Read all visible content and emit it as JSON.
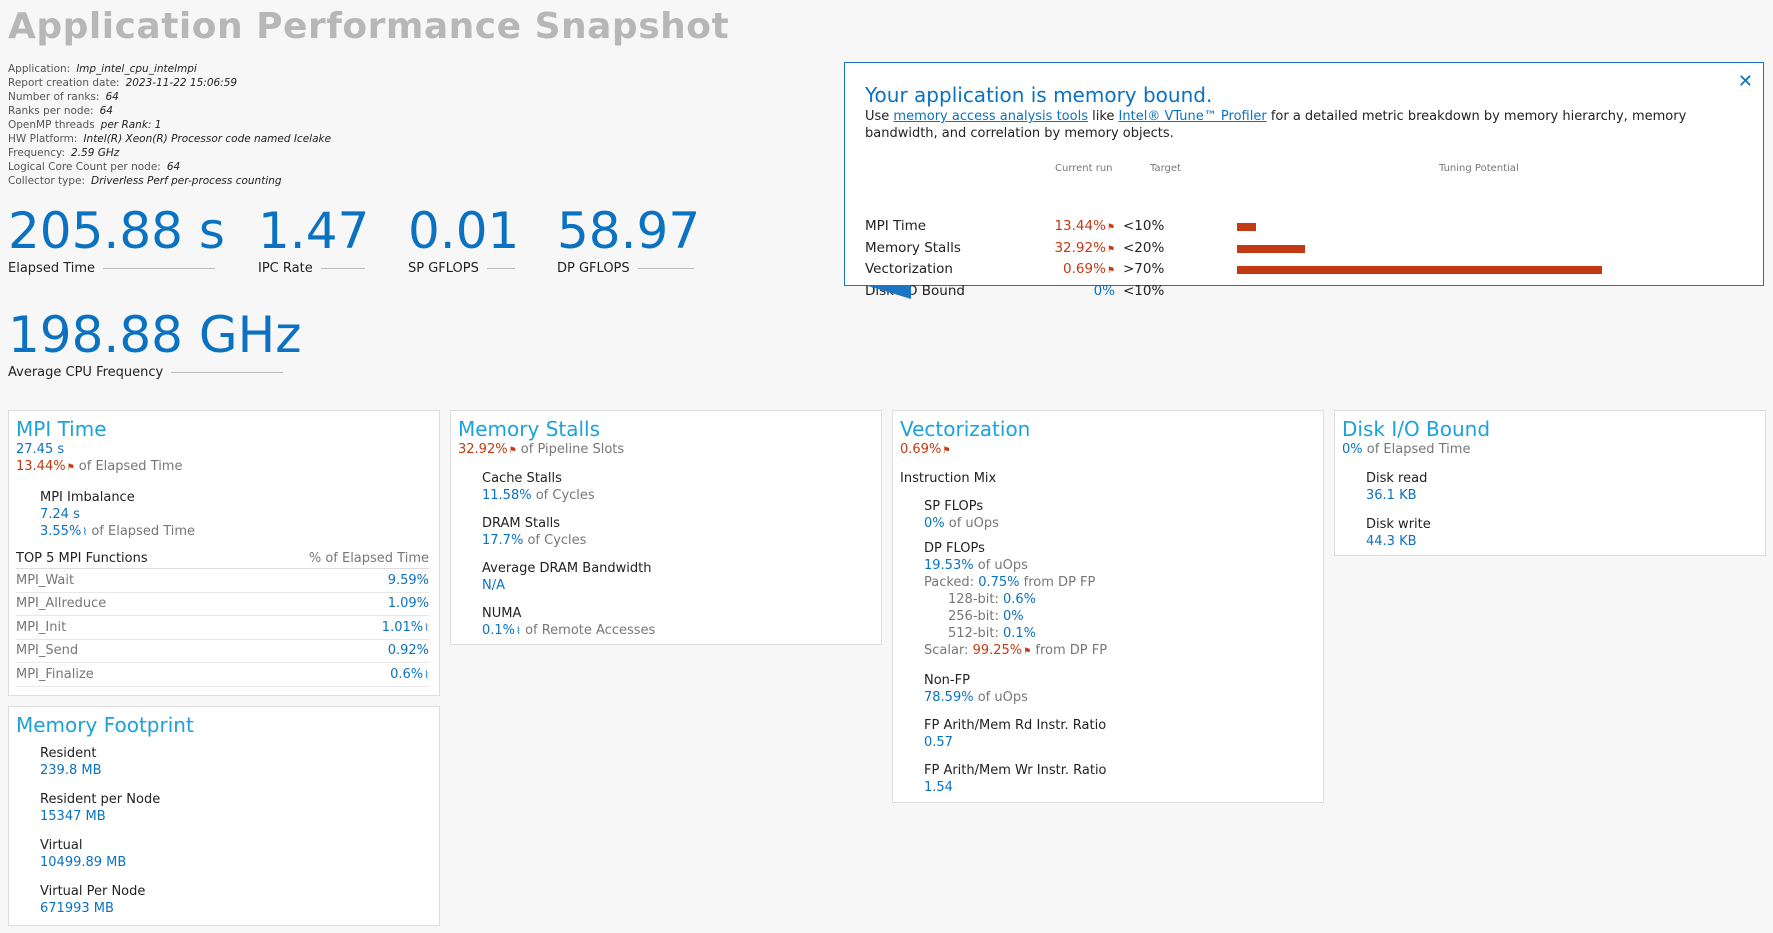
{
  "title": "Application Performance Snapshot",
  "meta": [
    {
      "k": "Application:",
      "v": "lmp_intel_cpu_intelmpi"
    },
    {
      "k": "Report creation date:",
      "v": "2023-11-22 15:06:59"
    },
    {
      "k": "Number of ranks:",
      "v": "64"
    },
    {
      "k": "Ranks per node:",
      "v": "64"
    },
    {
      "k": "OpenMP threads",
      "v": "per Rank:  1"
    },
    {
      "k": "HW Platform:",
      "v": "Intel(R) Xeon(R) Processor code named Icelake"
    },
    {
      "k": "Frequency:",
      "v": "2.59 GHz"
    },
    {
      "k": "Logical Core Count per node:",
      "v": "64"
    },
    {
      "k": "Collector type:",
      "v": "Driverless Perf per-process counting"
    }
  ],
  "metrics": {
    "elapsed": {
      "value": "205.88 s",
      "label": "Elapsed Time"
    },
    "ipc": {
      "value": "1.47",
      "label": "IPC Rate"
    },
    "sp": {
      "value": "0.01",
      "label": "SP GFLOPS"
    },
    "dp": {
      "value": "58.97",
      "label": "DP GFLOPS"
    },
    "freq": {
      "value": "198.88 GHz",
      "label": "Average CPU Frequency"
    }
  },
  "callout": {
    "title": "Your application is memory bound.",
    "desc_pre": "Use ",
    "link1": "memory access analysis tools",
    "desc_mid": " like ",
    "link2": "Intel® VTune™ Profiler",
    "desc_post": " for a detailed metric breakdown by memory hierarchy, memory bandwidth, and correlation by memory objects.",
    "close": "✕",
    "hdr_current": "Current run",
    "hdr_target": "Target",
    "hdr_potential": "Tuning Potential",
    "rows": [
      {
        "name": "MPI Time",
        "current": "13.44%",
        "target": "<10%",
        "potential": 0.05,
        "flag": true
      },
      {
        "name": "Memory Stalls",
        "current": "32.92%",
        "target": "<20%",
        "potential": 0.18,
        "flag": true
      },
      {
        "name": "Vectorization",
        "current": "0.69%",
        "target": ">70%",
        "potential": 0.96,
        "flag": true
      },
      {
        "name": "Disk I/O Bound",
        "current": "0%",
        "target": "<10%",
        "potential": 0,
        "flag": false
      }
    ]
  },
  "mpi": {
    "title": "MPI Time",
    "time": "27.45 s",
    "pct": "13.44%",
    "pct_suffix": "of Elapsed Time",
    "imbalance_label": "MPI Imbalance",
    "imbalance_time": "7.24 s",
    "imbalance_pct": "3.55%",
    "imbalance_suffix": "of Elapsed Time",
    "table_title": "TOP 5 MPI Functions",
    "table_col": "% of Elapsed Time",
    "functions": [
      {
        "name": "MPI_Wait",
        "value": "9.59%",
        "spark": false
      },
      {
        "name": "MPI_Allreduce",
        "value": "1.09%",
        "spark": false
      },
      {
        "name": "MPI_Init",
        "value": "1.01%",
        "spark": true
      },
      {
        "name": "MPI_Send",
        "value": "0.92%",
        "spark": false
      },
      {
        "name": "MPI_Finalize",
        "value": "0.6%",
        "spark": true
      }
    ]
  },
  "memory_footprint": {
    "title": "Memory Footprint",
    "items": [
      {
        "label": "Resident",
        "value": "239.8 MB"
      },
      {
        "label": "Resident per Node",
        "value": "15347 MB"
      },
      {
        "label": "Virtual",
        "value": "10499.89 MB"
      },
      {
        "label": "Virtual Per Node",
        "value": "671993 MB"
      }
    ]
  },
  "memory_stalls": {
    "title": "Memory Stalls",
    "pct": "32.92%",
    "suffix": "of Pipeline Slots",
    "items": [
      {
        "label": "Cache Stalls",
        "value": "11.58%",
        "suffix": "of Cycles"
      },
      {
        "label": "DRAM Stalls",
        "value": "17.7%",
        "suffix": "of Cycles"
      },
      {
        "label": "Average DRAM Bandwidth",
        "value": "N/A",
        "suffix": ""
      },
      {
        "label": "NUMA",
        "value": "0.1%",
        "suffix": "of Remote Accesses"
      }
    ]
  },
  "vectorization": {
    "title": "Vectorization",
    "pct": "0.69%",
    "mix_label": "Instruction Mix",
    "sp_label": "SP FLOPs",
    "sp_value": "0%",
    "sp_suffix": "of uOps",
    "dp_label": "DP FLOPs",
    "dp_value": "19.53%",
    "dp_suffix": "of uOps",
    "packed_label": "Packed:",
    "packed_value": "0.75%",
    "packed_suffix": "from DP FP",
    "b128_label": "128-bit:",
    "b128_value": "0.6%",
    "b256_label": "256-bit:",
    "b256_value": "0%",
    "b512_label": "512-bit:",
    "b512_value": "0.1%",
    "scalar_label": "Scalar:",
    "scalar_value": "99.25%",
    "scalar_suffix": "from DP FP",
    "nonfp_label": "Non-FP",
    "nonfp_value": "78.59%",
    "nonfp_suffix": "of uOps",
    "rd_label": "FP Arith/Mem Rd Instr. Ratio",
    "rd_value": "0.57",
    "wr_label": "FP Arith/Mem Wr Instr. Ratio",
    "wr_value": "1.54"
  },
  "disk": {
    "title": "Disk I/O Bound",
    "pct": "0%",
    "suffix": "of Elapsed Time",
    "read_label": "Disk read",
    "read_value": "36.1 KB",
    "write_label": "Disk write",
    "write_value": "44.3 KB"
  },
  "colors": {
    "accent": "#0b72c2",
    "warn": "#c23a13",
    "panel_title": "#1ba2dc"
  }
}
